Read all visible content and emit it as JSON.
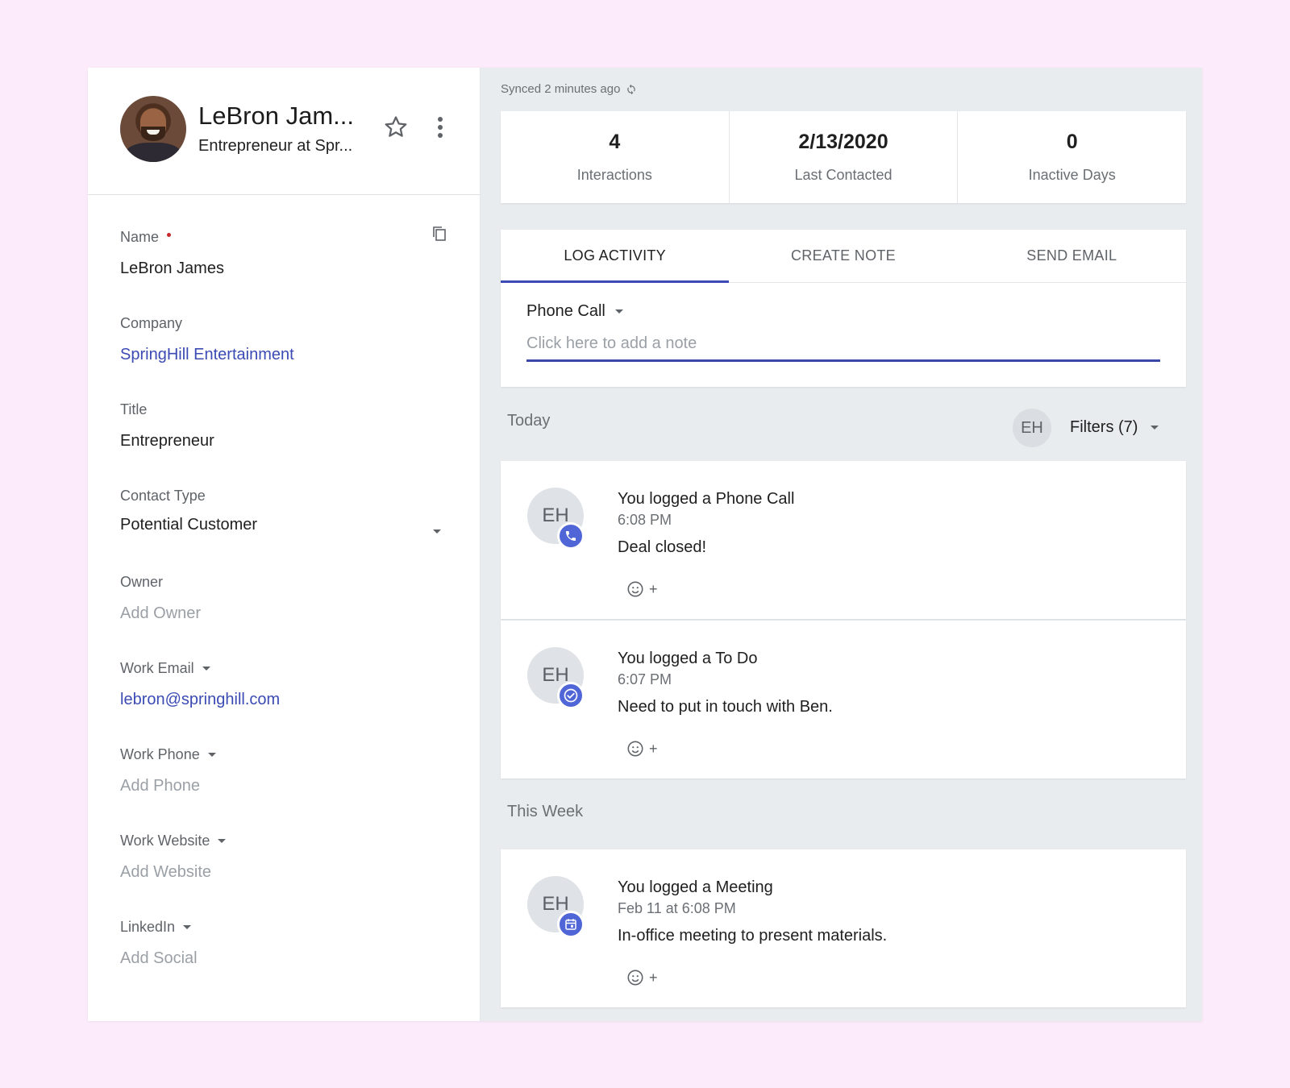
{
  "contact": {
    "header_name": "LeBron Jam...",
    "header_subtitle": "Entrepreneur at Spr..."
  },
  "fields": {
    "name": {
      "label": "Name",
      "value": "LeBron James"
    },
    "company": {
      "label": "Company",
      "value": "SpringHill Entertainment"
    },
    "title": {
      "label": "Title",
      "value": "Entrepreneur"
    },
    "contact_type": {
      "label": "Contact Type",
      "value": "Potential Customer"
    },
    "owner": {
      "label": "Owner",
      "value": "Add Owner"
    },
    "work_email": {
      "label": "Work Email",
      "value": "lebron@springhill.com"
    },
    "work_phone": {
      "label": "Work Phone",
      "value": "Add Phone"
    },
    "work_website": {
      "label": "Work Website",
      "value": "Add Website"
    },
    "linkedin": {
      "label": "LinkedIn",
      "value": "Add Social"
    }
  },
  "sync": {
    "text": "Synced 2 minutes ago"
  },
  "stats": [
    {
      "value": "4",
      "label": "Interactions"
    },
    {
      "value": "2/13/2020",
      "label": "Last Contacted"
    },
    {
      "value": "0",
      "label": "Inactive Days"
    }
  ],
  "composer": {
    "tabs": [
      "LOG ACTIVITY",
      "CREATE NOTE",
      "SEND EMAIL"
    ],
    "activity_type": "Phone Call",
    "note_placeholder": "Click here to add a note"
  },
  "timeline": {
    "today_label": "Today",
    "this_week_label": "This Week",
    "filter_avatar": "EH",
    "filters_label": "Filters (7)",
    "entries": [
      {
        "initials": "EH",
        "title": "You logged a Phone Call",
        "time": "6:08 PM",
        "body": "Deal closed!",
        "icon": "phone-icon"
      },
      {
        "initials": "EH",
        "title": "You logged a To Do",
        "time": "6:07 PM",
        "body": "Need to put in touch with Ben.",
        "icon": "check-circle-icon"
      },
      {
        "initials": "EH",
        "title": "You logged a Meeting",
        "time": "Feb 11 at 6:08 PM",
        "body": "In-office meeting to present materials.",
        "icon": "calendar-icon"
      }
    ],
    "reaction_plus": "+"
  },
  "colors": {
    "accent": "#3b4bb3",
    "badge": "#5065d6",
    "page_bg": "#fcebfb",
    "panel_bg": "#e9ecef"
  }
}
